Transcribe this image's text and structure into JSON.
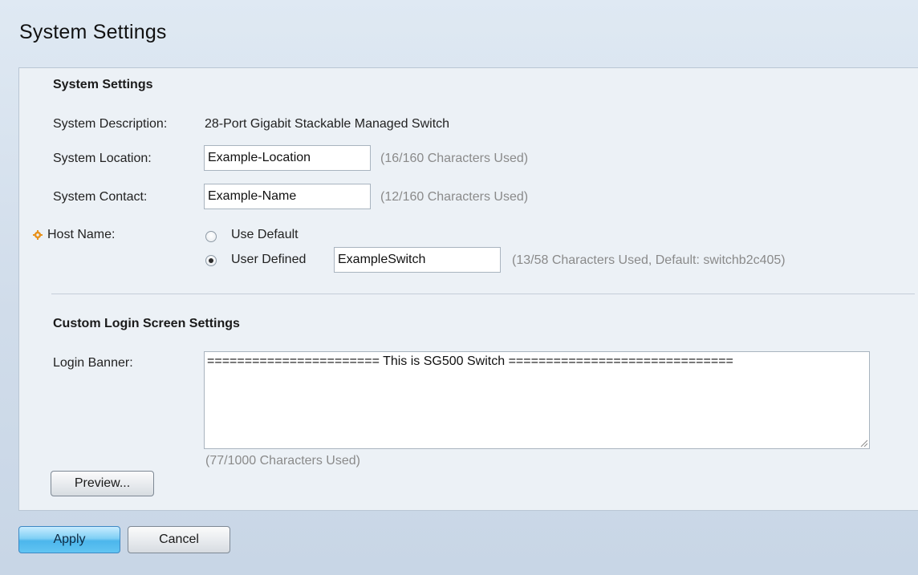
{
  "page": {
    "title": "System Settings"
  },
  "system_settings": {
    "heading": "System Settings",
    "description_label": "System Description:",
    "description_value": "28-Port Gigabit Stackable Managed Switch",
    "location_label": "System Location:",
    "location_value": "Example-Location",
    "location_hint": "(16/160 Characters Used)",
    "contact_label": "System Contact:",
    "contact_value": "Example-Name",
    "contact_hint": "(12/160 Characters Used)",
    "host_name_label": "Host Name:",
    "use_default_label": "Use Default",
    "user_defined_label": "User Defined",
    "host_name_value": "ExampleSwitch",
    "host_name_hint": "(13/58 Characters Used, Default: switchb2c405)",
    "selected_option": "User Defined"
  },
  "login_screen": {
    "heading": "Custom Login Screen Settings",
    "banner_label": "Login Banner:",
    "banner_value": "======================= This is SG500 Switch ==============================",
    "banner_hint": "(77/1000 Characters Used)",
    "preview_label": "Preview..."
  },
  "actions": {
    "apply_label": "Apply",
    "cancel_label": "Cancel"
  },
  "colors": {
    "primary_button": "#4cb6ec",
    "required_marker": "#e8921c",
    "hint_text": "#8a8a8a"
  }
}
